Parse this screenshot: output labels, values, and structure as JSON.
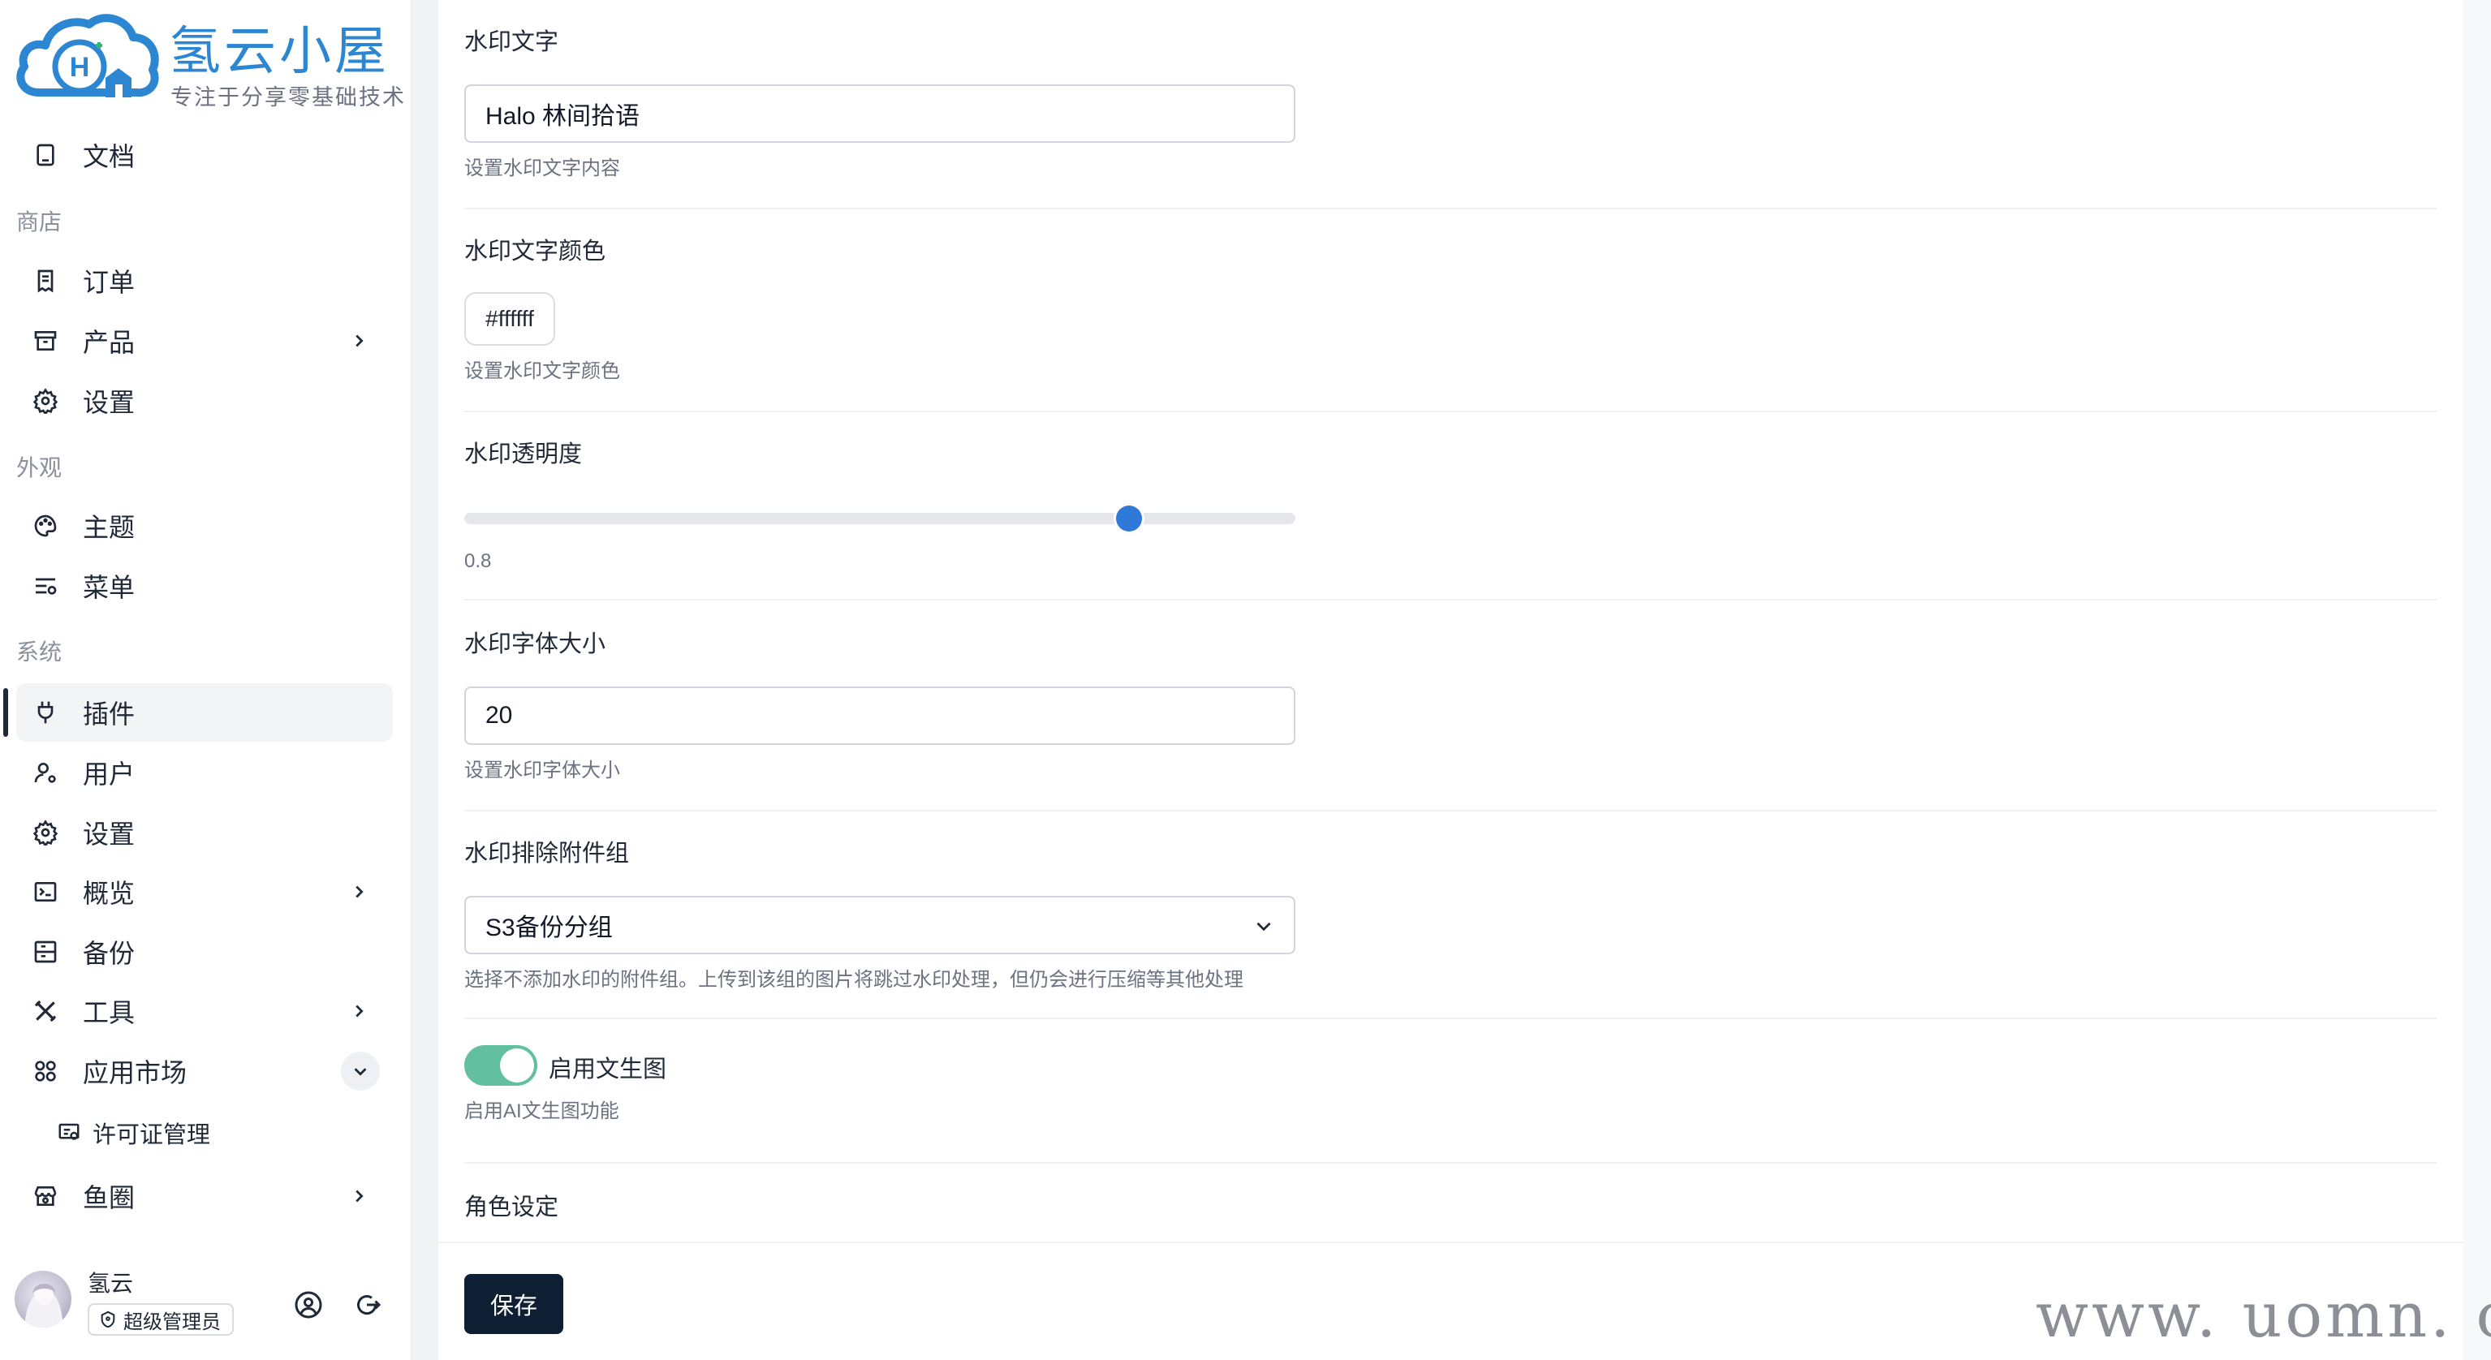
{
  "brand": {
    "title": "氢云小屋",
    "subtitle": "专注于分享零基础技术",
    "logo_letter": "H",
    "brand_color": "#2c86d1"
  },
  "sidebar": {
    "top_items": [
      {
        "label": "文档",
        "icon": "document-icon"
      }
    ],
    "section_shop": "商店",
    "shop_items": [
      {
        "label": "订单",
        "icon": "receipt-icon"
      },
      {
        "label": "产品",
        "icon": "archive-box-icon",
        "has_chevron": true
      },
      {
        "label": "设置",
        "icon": "gear-icon"
      }
    ],
    "section_appearance": "外观",
    "appearance_items": [
      {
        "label": "主题",
        "icon": "palette-icon"
      },
      {
        "label": "菜单",
        "icon": "menu-settings-icon"
      }
    ],
    "section_system": "系统",
    "system_items": [
      {
        "label": "插件",
        "icon": "plug-icon",
        "active": true
      },
      {
        "label": "用户",
        "icon": "user-settings-icon"
      },
      {
        "label": "设置",
        "icon": "gear-icon"
      },
      {
        "label": "概览",
        "icon": "terminal-icon",
        "has_chevron": true
      },
      {
        "label": "备份",
        "icon": "backup-icon"
      },
      {
        "label": "工具",
        "icon": "tools-icon",
        "has_chevron": true
      },
      {
        "label": "应用市场",
        "icon": "apps-grid-icon",
        "expanded": true
      }
    ],
    "app_market_sub": [
      {
        "label": "许可证管理",
        "icon": "license-icon"
      }
    ],
    "last_items": [
      {
        "label": "鱼圈",
        "icon": "store-icon",
        "has_chevron": true
      }
    ],
    "user": {
      "name": "氢云",
      "role": "超级管理员"
    }
  },
  "form": {
    "watermark_text": {
      "label": "水印文字",
      "value": "Halo 林间拾语",
      "help": "设置水印文字内容"
    },
    "watermark_color": {
      "label": "水印文字颜色",
      "value": "#ffffff",
      "help": "设置水印文字颜色"
    },
    "watermark_opacity": {
      "label": "水印透明度",
      "value": "0.8",
      "min": 0,
      "max": 1
    },
    "watermark_font_size": {
      "label": "水印字体大小",
      "value": "20",
      "help": "设置水印字体大小"
    },
    "watermark_exclude_group": {
      "label": "水印排除附件组",
      "value": "S3备份分组",
      "help": "选择不添加水印的附件组。上传到该组的图片将跳过水印处理，但仍会进行压缩等其他处理"
    },
    "enable_text_to_image": {
      "label": "启用文生图",
      "checked": true,
      "help": "启用AI文生图功能",
      "on_color": "#62c0a0"
    },
    "role_setting": {
      "label": "角色设定"
    }
  },
  "footer": {
    "save_label": "保存"
  },
  "watermark_overlay": "www. uomn. cn"
}
